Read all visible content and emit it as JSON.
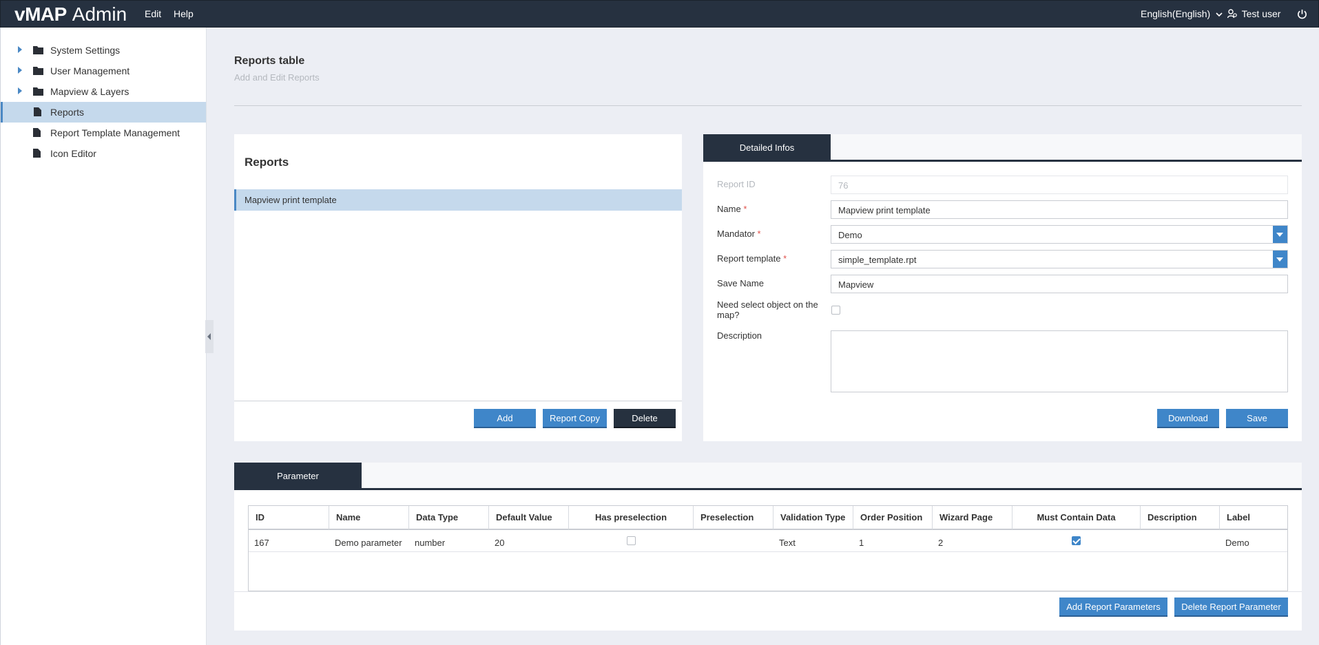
{
  "app": {
    "brand_strong": "vMAP",
    "brand_rest": "Admin"
  },
  "topbar": {
    "menu": [
      "Edit",
      "Help"
    ],
    "language": "English(English)",
    "user": "Test user"
  },
  "sidebar": {
    "items": [
      {
        "label": "System Settings",
        "type": "folder"
      },
      {
        "label": "User Management",
        "type": "folder"
      },
      {
        "label": "Mapview & Layers",
        "type": "folder"
      },
      {
        "label": "Reports",
        "type": "file",
        "active": true
      },
      {
        "label": "Report Template Management",
        "type": "file"
      },
      {
        "label": "Icon Editor",
        "type": "file"
      }
    ]
  },
  "page": {
    "title": "Reports table",
    "subtitle": "Add and Edit Reports"
  },
  "reports_panel": {
    "title": "Reports",
    "items": [
      "Mapview print template"
    ],
    "buttons": {
      "add": "Add",
      "copy": "Report Copy",
      "delete": "Delete"
    }
  },
  "details_panel": {
    "tab": "Detailed Infos",
    "fields": {
      "report_id": {
        "label": "Report ID",
        "value": "76"
      },
      "name": {
        "label": "Name",
        "value": "Mapview print template",
        "required": "*"
      },
      "mandator": {
        "label": "Mandator",
        "value": "Demo",
        "required": "*"
      },
      "report_template": {
        "label": "Report template",
        "value": "simple_template.rpt",
        "required": "*"
      },
      "save_name": {
        "label": "Save Name",
        "value": "Mapview"
      },
      "need_select": {
        "label_line1": "Need select object on the",
        "label_line2": "map?",
        "checked": false
      },
      "description": {
        "label": "Description",
        "value": ""
      }
    },
    "buttons": {
      "download": "Download",
      "save": "Save"
    }
  },
  "parameter_panel": {
    "tab": "Parameter",
    "columns": [
      "ID",
      "Name",
      "Data Type",
      "Default Value",
      "Has preselection",
      "Preselection",
      "Validation Type",
      "Order Position",
      "Wizard Page",
      "Must Contain Data",
      "Description",
      "Label"
    ],
    "rows": [
      {
        "id": "167",
        "name": "Demo parameter",
        "data_type": "number",
        "default_value": "20",
        "has_preselection": false,
        "preselection": "",
        "validation_type": "Text",
        "order_position": "1",
        "wizard_page": "2",
        "must_contain_data": true,
        "description": "",
        "label": "Demo"
      }
    ],
    "buttons": {
      "add": "Add Report Parameters",
      "delete": "Delete Report Parameter"
    }
  },
  "colors": {
    "topbar": "#263140",
    "accent": "#3f86c9",
    "selected_row": "#c5d9ec",
    "required": "#e0504a"
  }
}
